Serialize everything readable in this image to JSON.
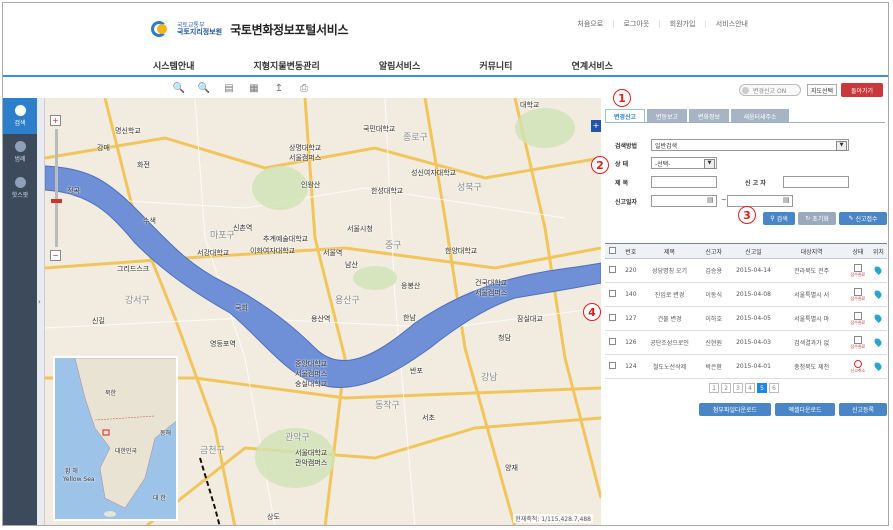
{
  "header": {
    "logo_small": "국토교통부",
    "logo_org": "국토지리정보원",
    "title": "국토변화정보포털서비스",
    "top_links": [
      "처음으로",
      "로그아웃",
      "회원가입",
      "서비스안내"
    ],
    "nav": [
      "시스템안내",
      "지형지물변동관리",
      "알림서비스",
      "커뮤니티",
      "연계서비스"
    ]
  },
  "toolbar": {
    "icons": [
      "zoom-in-tool-icon",
      "zoom-out-tool-icon",
      "distance-tool-icon",
      "area-tool-icon",
      "save-tool-icon",
      "print-tool-icon"
    ],
    "toggle_label": "변경신고 ON",
    "map_select": "지도선택",
    "back": "돌아가기"
  },
  "sidenav": [
    {
      "label": "검색",
      "icon": "search-icon",
      "active": true
    },
    {
      "label": "범례",
      "icon": "legend-icon",
      "active": false
    },
    {
      "label": "핫스팟",
      "icon": "hotspot-icon",
      "active": false
    }
  ],
  "map": {
    "places": [
      "대학교",
      "명신학교",
      "강매",
      "화전",
      "정곡",
      "수색",
      "신촌역",
      "이화여자대학교",
      "서울시청",
      "서울역",
      "용산역",
      "국회",
      "영등포역",
      "신길",
      "그리드스크",
      "중앙대학교",
      "서울캠퍼스",
      "숭실대학교",
      "관악구",
      "서울대학교",
      "관악캠퍼스",
      "상도",
      "국민대학교",
      "상명대학교",
      "서울캠퍼스",
      "인왕산",
      "한성대학교",
      "성신여자대학교",
      "추계예술대학교",
      "서강대학교",
      "성북구",
      "남산",
      "한남",
      "반포",
      "한양대학교",
      "건국대학교",
      "서울캠퍼스",
      "청담",
      "서초",
      "양재",
      "강남",
      "응봉산",
      "잠실대교",
      "마포구",
      "용산구",
      "종로구",
      "중구",
      "동작구",
      "금천구",
      "강서구"
    ],
    "overview_labels": [
      "북한",
      "대한민국",
      "황 해",
      "Yellow Sea",
      "동해",
      "대 한"
    ],
    "scale": "현재축척: 1/115,428.7,488"
  },
  "panel": {
    "tabs": [
      "변경신고",
      "변동보고",
      "변화정보",
      "새움터새주소"
    ],
    "form": {
      "method_label": "검색방법",
      "method_value": "일반검색",
      "status_label": "상 태",
      "status_value": "-선택-",
      "title_label": "제 목",
      "reporter_label": "신 고 자",
      "date_label": "신고일자",
      "date_sep": "~"
    },
    "buttons": {
      "search": "검색",
      "reset": "초기화",
      "report": "신고접수"
    },
    "table": {
      "headers": [
        "번호",
        "제목",
        "신고자",
        "신고일",
        "대상지역",
        "상태",
        "위치"
      ],
      "rows": [
        {
          "no": "220",
          "title": "성당명칭 오기",
          "reporter": "김승용",
          "date": "2015-04-14",
          "region": "전라북도 전주",
          "status": "접수완료"
        },
        {
          "no": "140",
          "title": "진입로 변경",
          "reporter": "이동식",
          "date": "2015-04-08",
          "region": "서울특별시 서",
          "status": "접수완료"
        },
        {
          "no": "127",
          "title": "건물 변경",
          "reporter": "이하호",
          "date": "2015-04-05",
          "region": "서울특별시 마",
          "status": "접수완료"
        },
        {
          "no": "126",
          "title": "공단조성으로인",
          "reporter": "신현원",
          "date": "2015-04-03",
          "region": "검색결과가 없",
          "status": "접수완료"
        },
        {
          "no": "124",
          "title": "철도노선삭제",
          "reporter": "박은환",
          "date": "2015-04-01",
          "region": "충청북도 제천",
          "status": "신고취소"
        }
      ]
    },
    "pages": [
      "1",
      "2",
      "3",
      "4",
      "5",
      "6"
    ],
    "current_page": "5",
    "bottom_buttons": [
      "첨부파일다운로드",
      "엑셀다운로드",
      "신고등록"
    ]
  },
  "callouts": [
    "1",
    "2",
    "3",
    "4"
  ],
  "colors": {
    "accent": "#2e7fcb",
    "river": "#6f8fd6",
    "danger": "#c9383c"
  }
}
